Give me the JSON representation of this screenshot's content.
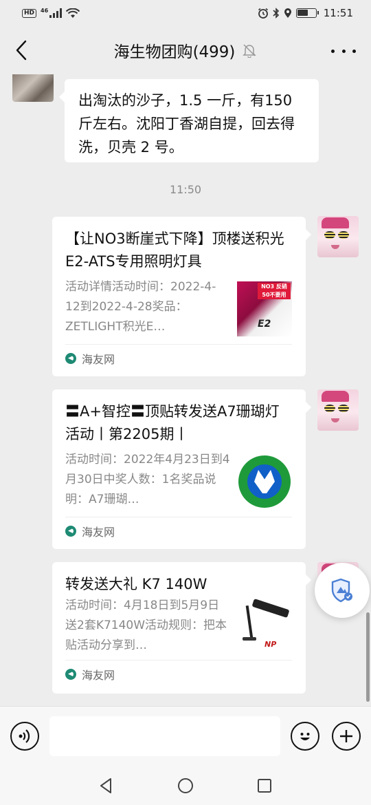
{
  "status_bar": {
    "hd": "HD",
    "network": "46",
    "time": "11:51"
  },
  "header": {
    "title": "海生物团购(499)"
  },
  "message": {
    "text": "出淘汰的沙子，1.5 一斤，有150 斤左右。沈阳丁香湖自提，回去得洗，贝壳 2 号。"
  },
  "timestamp": "11:50",
  "cards": [
    {
      "title": "【让NO3断崖式下降】顶楼送积光E2-ATS专用照明灯具",
      "desc": "活动详情活动时间：2022-4-12到2022-4-28奖品：ZETLIGHT积光E…",
      "thumb_badge": "NO3 反硝\n50不要用",
      "thumb_label": "E2",
      "source": "海友网"
    },
    {
      "title": "〓A+智控〓顶贴转发送A7珊瑚灯活动丨第2205期丨",
      "desc": "活动时间：2022年4月23日到4月30日中奖人数：1名奖品说明：A7珊瑚…",
      "source": "海友网"
    },
    {
      "title": "转发送大礼 K7 140W",
      "desc": "活动时间：4月18日到5月9日送2套K7140W活动规则：把本贴活动分享到…",
      "thumb_label": "NP",
      "source": "海友网"
    }
  ],
  "input": {
    "value": "",
    "placeholder": ""
  },
  "colors": {
    "background": "#ededed",
    "bubble": "#ffffff",
    "muted_text": "#888888",
    "source_green": "#1e8a74",
    "security_blue": "#4a7fd4"
  },
  "icons": {
    "back": "chevron-left-icon",
    "mute": "bell-off-icon",
    "more": "more-dots-icon",
    "voice": "voice-icon",
    "emoji": "smile-icon",
    "plus": "plus-icon",
    "security": "shield-icon"
  }
}
